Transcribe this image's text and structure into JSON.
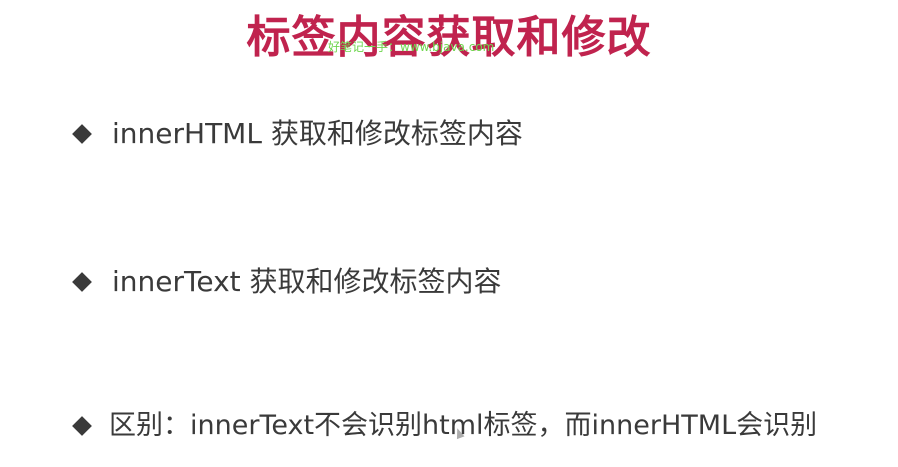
{
  "slide": {
    "title": "标签内容获取和修改",
    "watermark": "好笔记一手：www.bjava.com",
    "bullets": [
      "innerHTML 获取和修改标签内容",
      "innerText 获取和修改标签内容",
      "区别：innerText不会识别html标签，而innerHTML会识别"
    ]
  },
  "colors": {
    "title": "#c0234e",
    "text": "#3a3a3a",
    "watermark": "#6fd64f"
  }
}
